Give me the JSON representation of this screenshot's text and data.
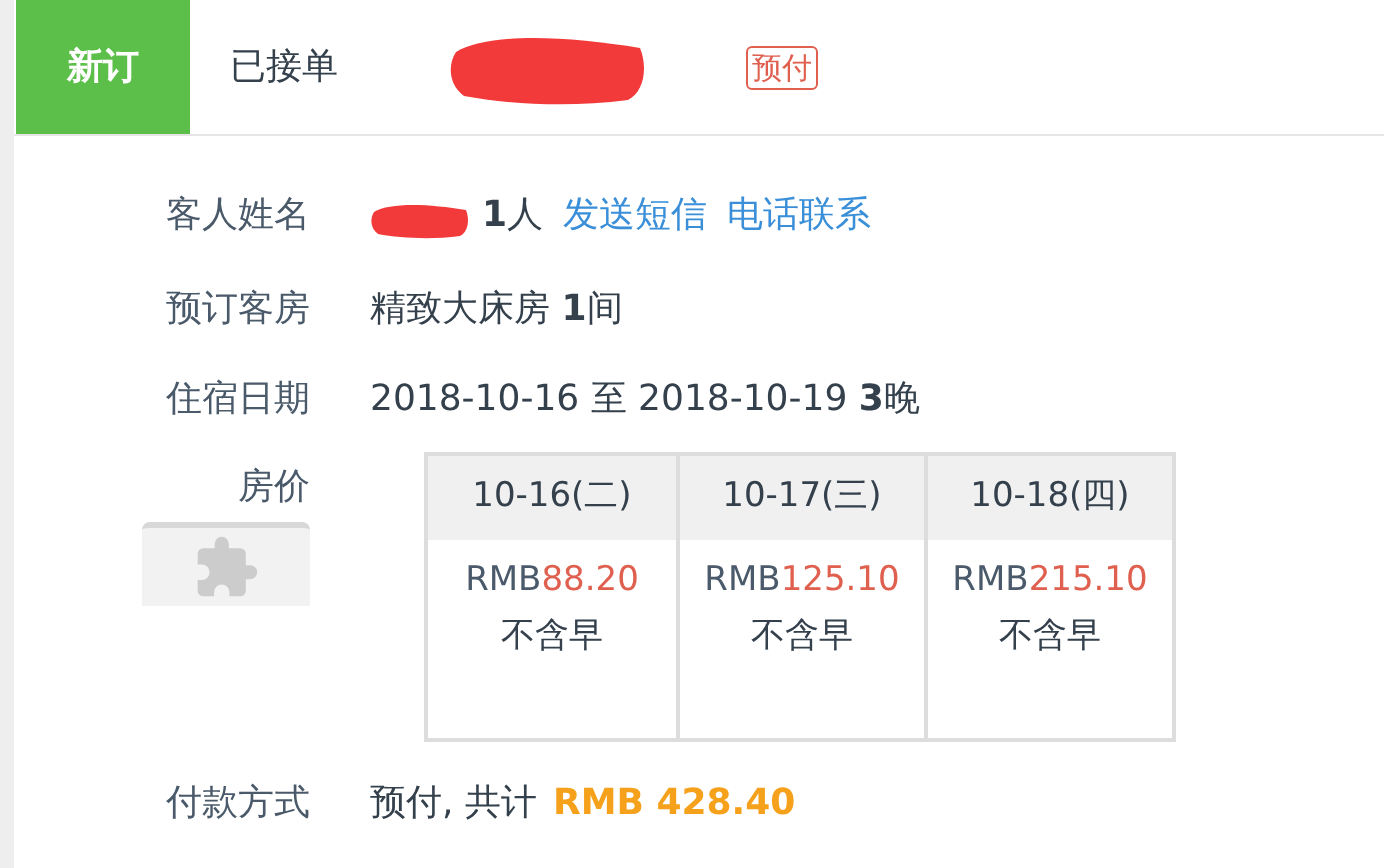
{
  "header": {
    "tab": "新订",
    "status": "已接单",
    "badge": "预付"
  },
  "guest": {
    "label": "客人姓名",
    "count": "**1**人",
    "links": [
      "发送短信",
      "电话联系"
    ]
  },
  "room": {
    "label": "预订客房",
    "value": "精致大床房 **1**间"
  },
  "stay": {
    "label": "住宿日期",
    "value": "2018-10-16 至 2018-10-19 **3**晚"
  },
  "price": {
    "label": "房价",
    "days": [
      {
        "date": "10-16(二)",
        "currency": "RMB",
        "amount": "88.20",
        "breakfast": "不含早"
      },
      {
        "date": "10-17(三)",
        "currency": "RMB",
        "amount": "125.10",
        "breakfast": "不含早"
      },
      {
        "date": "10-18(四)",
        "currency": "RMB",
        "amount": "215.10",
        "breakfast": "不含早"
      }
    ]
  },
  "payment": {
    "label": "付款方式",
    "value": "预付, 共计",
    "total": "RMB 428.40"
  }
}
